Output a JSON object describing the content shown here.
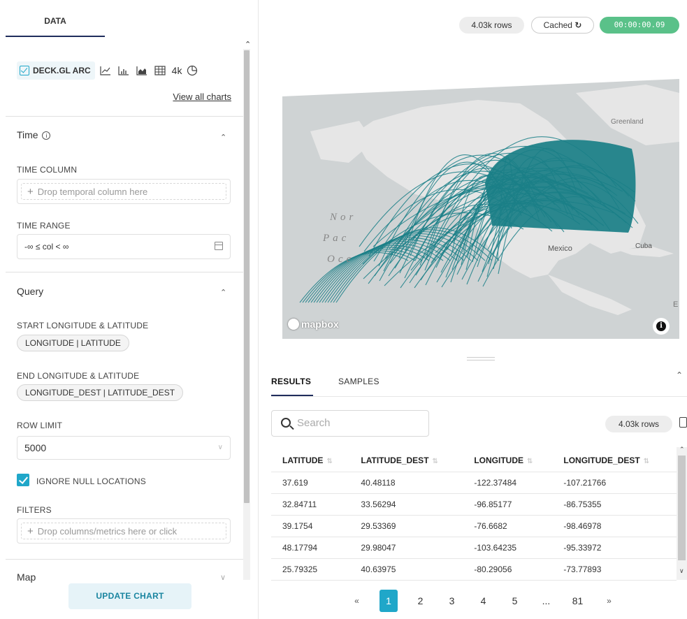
{
  "left_panel": {
    "tab": "DATA",
    "viz_type": "DECK.GL ARC",
    "viz_4k": "4k",
    "view_all": "View all charts",
    "time": {
      "title": "Time",
      "column_label": "TIME COLUMN",
      "column_placeholder": "Drop temporal column here",
      "range_label": "TIME RANGE",
      "range_value": "-∞ ≤ col < ∞"
    },
    "query": {
      "title": "Query",
      "start_label": "START LONGITUDE & LATITUDE",
      "start_value": "LONGITUDE | LATITUDE",
      "end_label": "END LONGITUDE & LATITUDE",
      "end_value": "LONGITUDE_DEST | LATITUDE_DEST",
      "row_limit_label": "ROW LIMIT",
      "row_limit_value": "5000",
      "ignore_null_label": "IGNORE NULL LOCATIONS",
      "filters_label": "FILTERS",
      "filters_placeholder": "Drop columns/metrics here or click"
    },
    "map_title": "Map",
    "update_button": "UPDATE CHART"
  },
  "status": {
    "rows": "4.03k rows",
    "cached": "Cached",
    "elapsed": "00:00:00.09"
  },
  "map": {
    "labels": {
      "greenland": "Greenland",
      "mexico": "Mexico",
      "cuba": "Cuba",
      "north": "Nor",
      "pacific": "Pac",
      "ocean": "Oce",
      "edge": "E"
    },
    "attribution": "mapbox",
    "colors": {
      "land": "#e6e6e6",
      "water": "#cfd3d4",
      "arc": "#1a7f87"
    }
  },
  "results": {
    "tabs": [
      "RESULTS",
      "SAMPLES"
    ],
    "search_placeholder": "Search",
    "rows_badge": "4.03k rows",
    "columns": [
      "LATITUDE",
      "LATITUDE_DEST",
      "LONGITUDE",
      "LONGITUDE_DEST"
    ],
    "rows": [
      [
        "37.619",
        "40.48118",
        "-122.37484",
        "-107.21766"
      ],
      [
        "32.84711",
        "33.56294",
        "-96.85177",
        "-86.75355"
      ],
      [
        "39.1754",
        "29.53369",
        "-76.6682",
        "-98.46978"
      ],
      [
        "48.17794",
        "29.98047",
        "-103.64235",
        "-95.33972"
      ],
      [
        "25.79325",
        "40.63975",
        "-80.29056",
        "-73.77893"
      ]
    ],
    "pagination": {
      "prev": "«",
      "pages": [
        "1",
        "2",
        "3",
        "4",
        "5",
        "...",
        "81"
      ],
      "next": "»",
      "current": "1"
    }
  }
}
